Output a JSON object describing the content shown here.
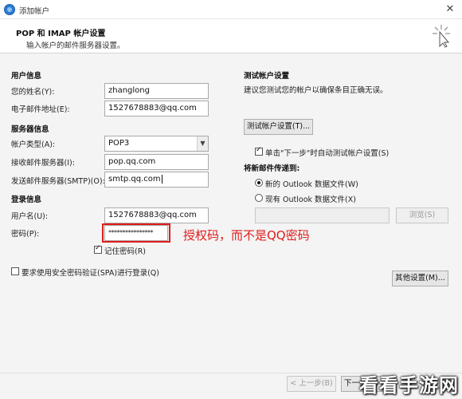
{
  "window": {
    "title": "添加帐户",
    "close_glyph": "✕"
  },
  "header": {
    "title": "POP 和 IMAP 帐户设置",
    "subtitle": "输入帐户的邮件服务器设置。"
  },
  "user_info": {
    "section_label": "用户信息",
    "name_label": "您的姓名(Y):",
    "name_value": "zhanglong",
    "email_label": "电子邮件地址(E):",
    "email_value": "1527678883@qq.com"
  },
  "server_info": {
    "section_label": "服务器信息",
    "account_type_label": "帐户类型(A):",
    "account_type_value": "POP3",
    "incoming_label": "接收邮件服务器(I):",
    "incoming_value": "pop.qq.com",
    "outgoing_label": "发送邮件服务器(SMTP)(O):",
    "outgoing_value": "smtp.qq.com"
  },
  "login_info": {
    "section_label": "登录信息",
    "username_label": "用户名(U):",
    "username_value": "1527678883@qq.com",
    "password_label": "密码(P):",
    "password_value": "****************",
    "remember_label": "记住密码(R)",
    "spa_label": "要求使用安全密码验证(SPA)进行登录(Q)"
  },
  "annotation": {
    "text": "授权码，而不是QQ密码",
    "color": "#e11d1d"
  },
  "test_settings": {
    "section_label": "测试帐户设置",
    "description": "建议您测试您的帐户以确保条目正确无误。",
    "test_button": "测试帐户设置(T)...",
    "auto_test_label": "单击\"下一步\"时自动测试帐户设置(S)"
  },
  "deliver_to": {
    "section_label": "将新邮件传递到:",
    "new_file_label": "新的 Outlook 数据文件(W)",
    "existing_file_label": "现有 Outlook 数据文件(X)",
    "browse_button": "浏览(S)"
  },
  "more_settings_button": "其他设置(M)...",
  "footer": {
    "back_button": "< 上一步(B)",
    "next_button": "下一步(N) >"
  },
  "watermark": "看看手游网"
}
